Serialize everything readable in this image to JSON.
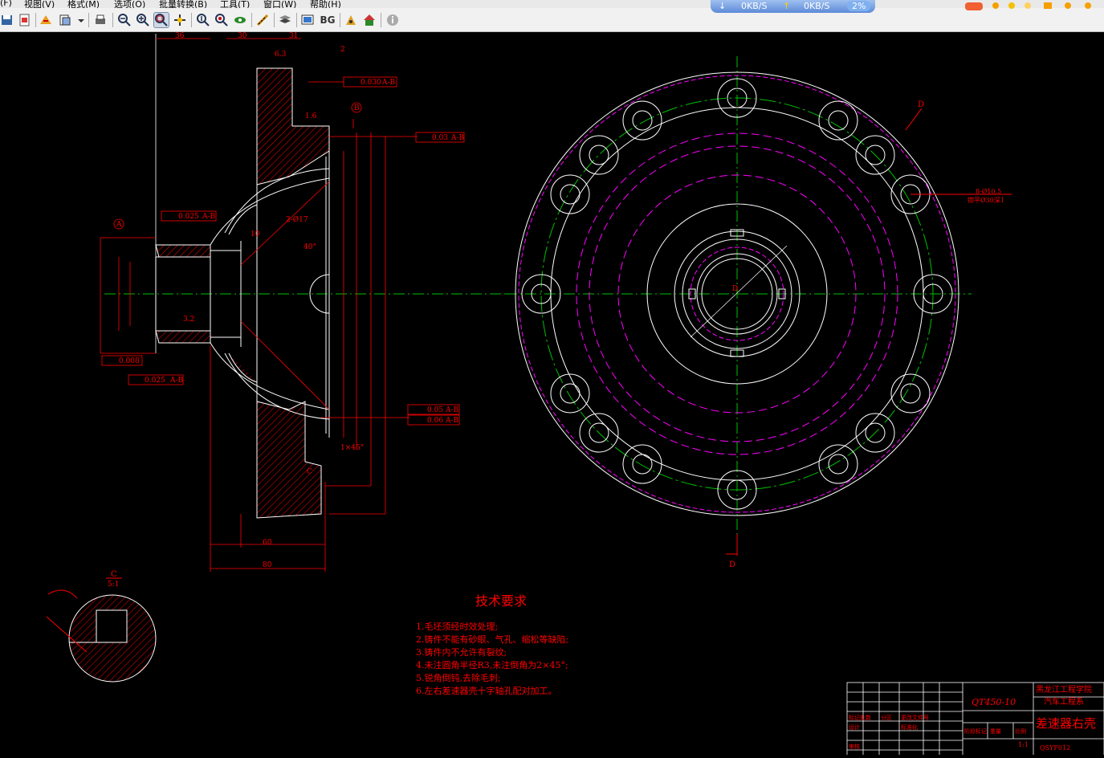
{
  "menu": {
    "file": "(F)",
    "view": "视图(V)",
    "format": "格式(M)",
    "options": "选项(O)",
    "batch": "批量转换(B)",
    "tools": "工具(T)",
    "window": "窗口(W)",
    "help": "帮助(H)"
  },
  "toolbar": {
    "bg_label": "BG"
  },
  "netmon": {
    "down": "0KB/S",
    "up": "0KB/S",
    "cpu": "2%"
  },
  "colors": {
    "background": "#000000",
    "geometry": "#ffffff",
    "dimension": "#ff0000",
    "centerline": "#00c000",
    "hidden": "#ff00ff"
  },
  "drawing": {
    "title_tech": "技术要求",
    "requirements": [
      "1.毛坯须经时效处理;",
      "2.铸件不能有砂眼、气孔、缩松等缺陷;",
      "3.铸件内不允许有裂纹;",
      "4.未注圆角半径R3,未注倒角为2×45°;",
      "5.锐角倒钝,去除毛刺;",
      "6.左右差速器壳十字轴孔配对加工。"
    ],
    "detail_label": "C",
    "detail_scale": "5:1",
    "section_d": "D",
    "dims": {
      "d60": "60",
      "d80": "80",
      "d36": "36",
      "d30": "30",
      "d31": "31",
      "d2": "2",
      "chamfer": "1×45°",
      "tol1": "0.030",
      "tol1_ref": "A-B",
      "tol2": "0.03",
      "tol2_ref": "A-B",
      "tol3": "0.025",
      "tol3_ref": "A-B",
      "tol4": "0.008",
      "tol5": "0.025",
      "tol5_ref": "A-B",
      "tol6": "0.05",
      "tol6_ref": "A-B",
      "tol7": "0.06",
      "tol7_ref": "A-B",
      "hole_note_1": "8-Ø10.5",
      "hole_note_2": "锪平Ø30深1",
      "datum_a": "A",
      "datum_b": "B",
      "angle": "40°",
      "holes2": "2-Ø17",
      "ra63": "6.3",
      "ra32": "3.2",
      "ra16": "1.6",
      "d10": "10"
    },
    "title_block": {
      "material": "QT450-10",
      "school": "黑龙江工程学院",
      "dept": "汽车工程系",
      "part_name": "差速器右壳",
      "code": "QSYF012",
      "scale": "1:1",
      "row_labels": [
        "标记处数",
        "分区",
        "更改文件号",
        "设计",
        "标准化",
        "审核",
        "阶段标记",
        "重量",
        "比例"
      ]
    }
  }
}
